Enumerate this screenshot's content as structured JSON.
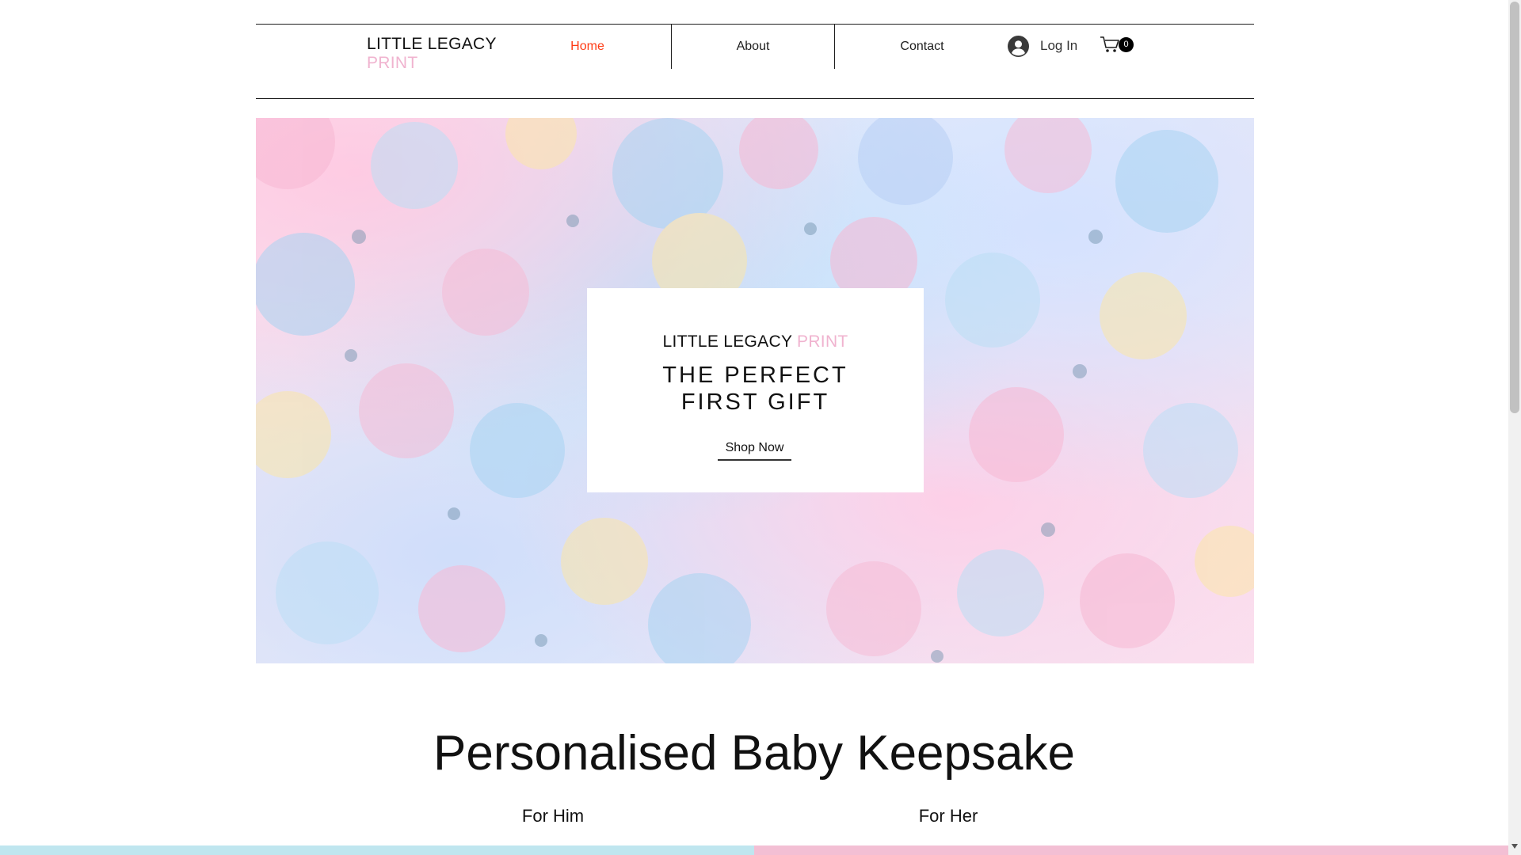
{
  "logo": {
    "line1": "LITTLE LEGACY",
    "line2": "PRINT"
  },
  "nav": {
    "items": [
      {
        "label": "Home",
        "active": true
      },
      {
        "label": "About",
        "active": false
      },
      {
        "label": "Contact",
        "active": false
      }
    ]
  },
  "account": {
    "login_label": "Log In",
    "avatar_icon": "user-avatar-icon"
  },
  "cart": {
    "icon": "shopping-cart-icon",
    "count": "0"
  },
  "hero": {
    "brand_part1": "LITTLE LEGACY",
    "brand_part2": "PRINT",
    "headline_line1": "THE PERFECT",
    "headline_line2": "FIRST GIFT",
    "cta_label": "Shop Now"
  },
  "section": {
    "title": "Personalised Baby Keepsake",
    "col1_label": "For Him",
    "col2_label": "For Her"
  },
  "colors": {
    "accent_active_nav": "#ff3b14",
    "brand_pink": "#f0b3cf",
    "band_him": "#bfe6ef",
    "band_her": "#f3bfd4"
  }
}
